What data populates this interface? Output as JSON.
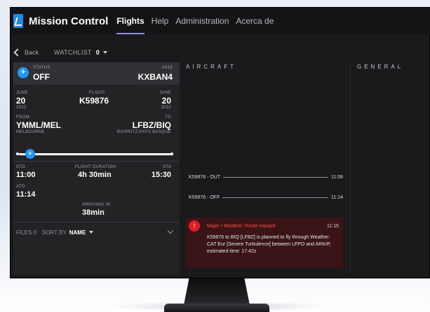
{
  "app": {
    "title": "Mission Control",
    "nav": [
      "Flights",
      "Help",
      "Administration",
      "Acerca de"
    ]
  },
  "subbar": {
    "back_label": "Back",
    "watchlist_label": "WATCHLIST",
    "watchlist_count": "0"
  },
  "flight_card": {
    "status_label": "STATUS",
    "status_value": "OFF",
    "aircraft_type": "A318",
    "registration": "KXBAN4",
    "departure_month": "JUNE",
    "departure_day": "20",
    "departure_year": "2022",
    "flight_label": "FLIGHT",
    "flight_number": "K59876",
    "arrival_month": "JUNE",
    "arrival_day": "20",
    "arrival_year": "2022",
    "from_label": "FROM",
    "from_code": "YMML/MEL",
    "from_city": "MELBOURNE",
    "to_label": "TO",
    "to_code": "LFBZ/BIQ",
    "to_city": "BIARRITZ-PAYS BASQUE",
    "progress": 0.05,
    "std_label": "STD",
    "std_value": "11:00",
    "duration_label": "FLIGHT DURATION",
    "duration_value": "4h 30min",
    "sta_label": "STA",
    "sta_value": "15:30",
    "atd_label": "ATD",
    "atd_value": "11:14",
    "arriving_label": "ARRIVING IN",
    "arriving_value": "38min"
  },
  "files": {
    "count_label": "FILES 0",
    "sort_label": "SORT BY",
    "sort_value": "NAME"
  },
  "aircraft": {
    "heading": "AIRCRAFT",
    "events": [
      {
        "text": "K59876  -  OUT",
        "time": "11:08"
      },
      {
        "text": "K59876  -  OFF",
        "time": "11:14"
      }
    ],
    "alert": {
      "title": "Major • Weather: Route Hazard",
      "time": "11:15",
      "body": "K59876 to BIQ [LFBZ] is planned to fly through Weather: CAT Eur [Severe Turbulence] between LFPO and ARKIP, estimated time: 17:42z",
      "color": "#e11d25"
    }
  },
  "general": {
    "heading": "GENERAL"
  }
}
